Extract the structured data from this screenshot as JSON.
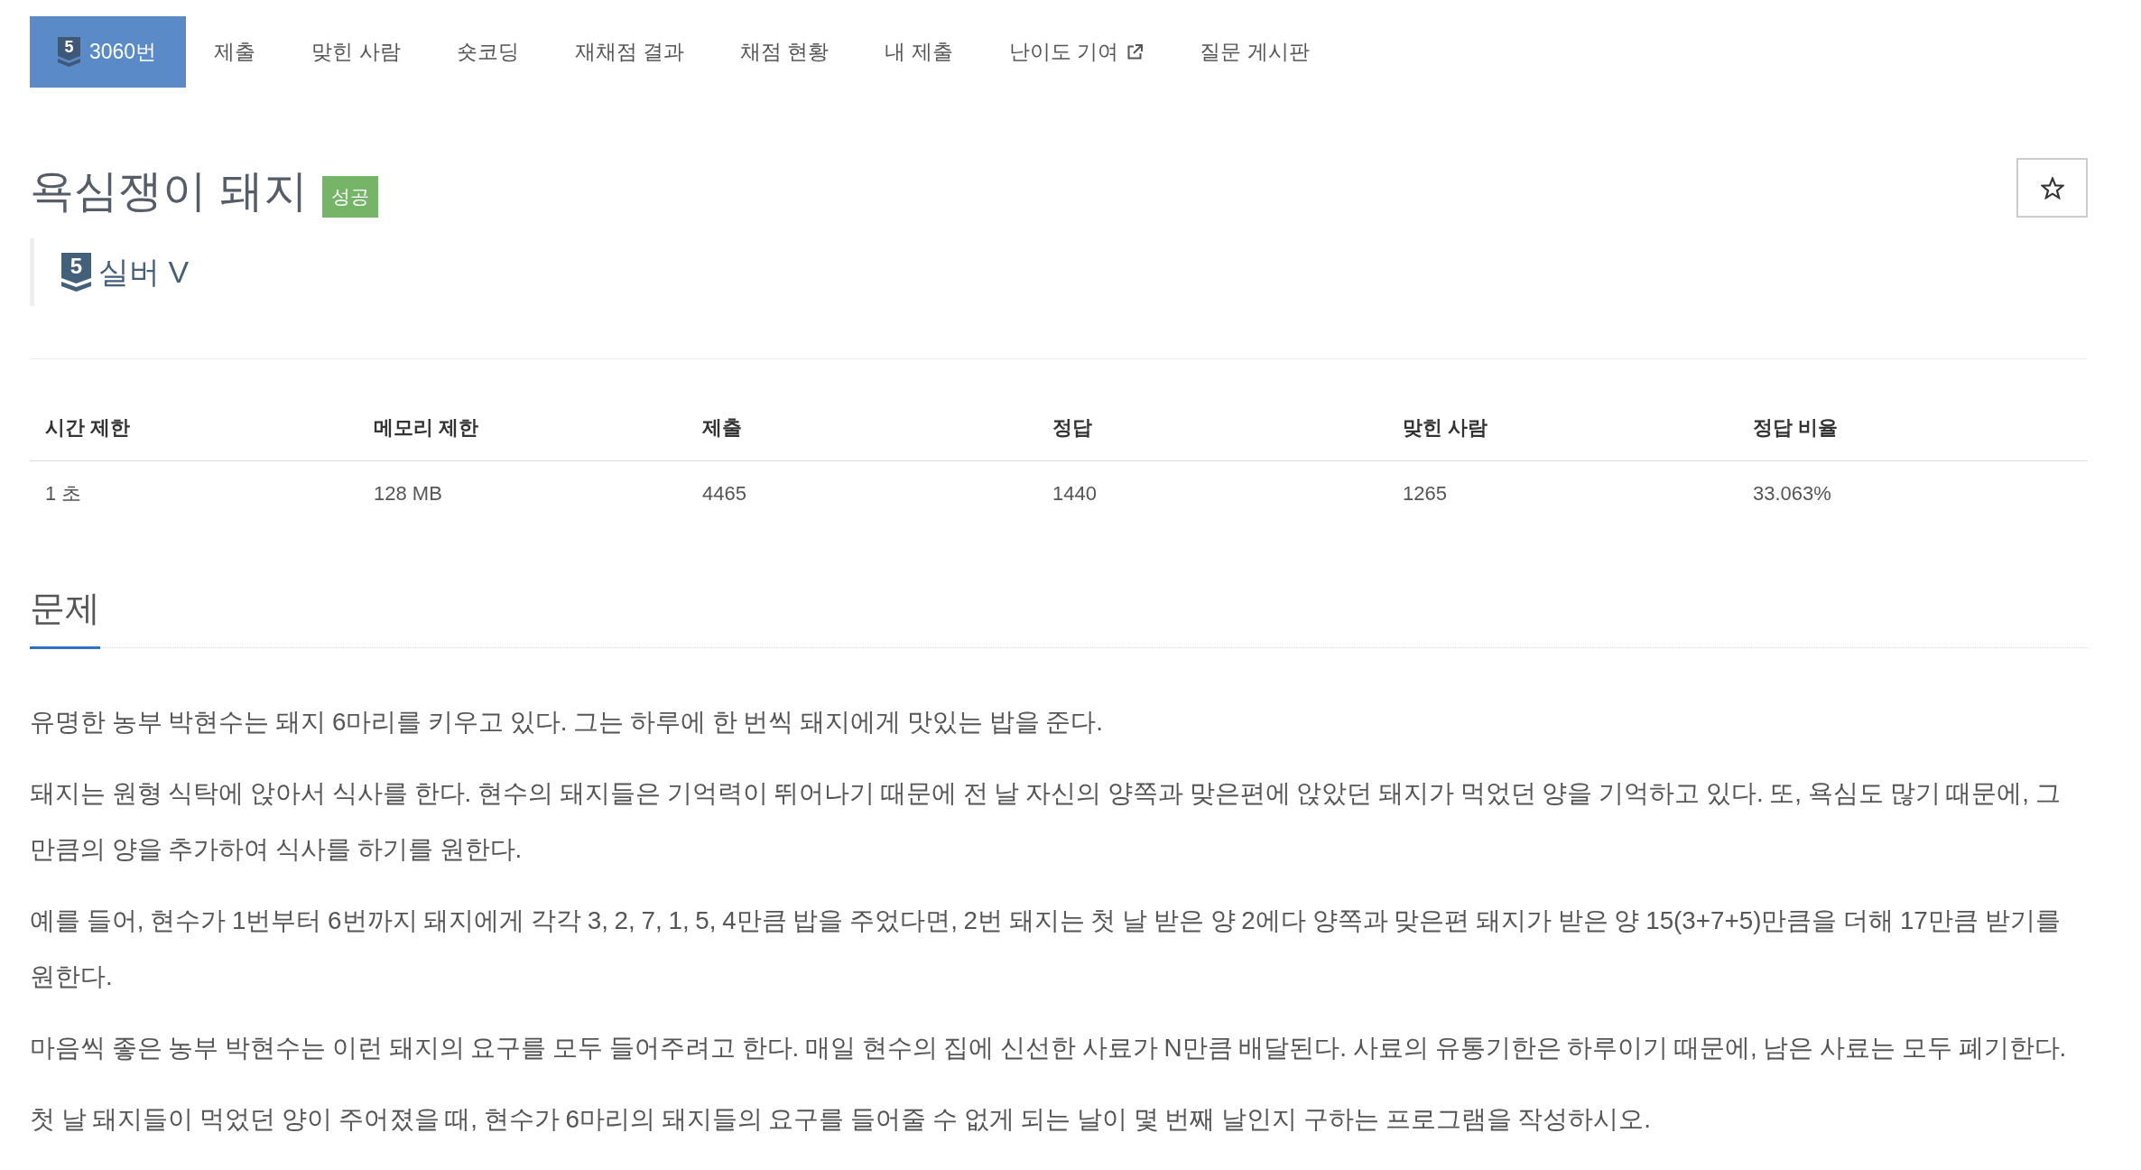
{
  "nav_tabs": [
    {
      "label": "3060번",
      "tier": "5",
      "selected": true,
      "external": false
    },
    {
      "label": "제출",
      "selected": false,
      "external": false
    },
    {
      "label": "맞힌 사람",
      "selected": false,
      "external": false
    },
    {
      "label": "숏코딩",
      "selected": false,
      "external": false
    },
    {
      "label": "재채점 결과",
      "selected": false,
      "external": false
    },
    {
      "label": "채점 현황",
      "selected": false,
      "external": false
    },
    {
      "label": "내 제출",
      "selected": false,
      "external": false
    },
    {
      "label": "난이도 기여",
      "selected": false,
      "external": true
    },
    {
      "label": "질문 게시판",
      "selected": false,
      "external": false
    }
  ],
  "problem": {
    "title": "욕심쟁이 돼지",
    "status_badge": "성공",
    "tier": {
      "level": "5",
      "name": "실버 V"
    }
  },
  "info_table": {
    "columns": [
      "시간 제한",
      "메모리 제한",
      "제출",
      "정답",
      "맞힌 사람",
      "정답 비율"
    ],
    "rows": [
      [
        "1 초",
        "128 MB",
        "4465",
        "1440",
        "1265",
        "33.063%"
      ]
    ]
  },
  "section": {
    "heading": "문제",
    "paragraphs": [
      "유명한 농부 박현수는 돼지 6마리를 키우고 있다. 그는 하루에 한 번씩 돼지에게 맛있는 밥을 준다.",
      "돼지는 원형 식탁에 앉아서 식사를 한다. 현수의 돼지들은 기억력이 뛰어나기 때문에 전 날 자신의 양쪽과 맞은편에 앉았던 돼지가 먹었던 양을 기억하고 있다. 또, 욕심도 많기 때문에, 그 만큼의 양을 추가하여 식사를 하기를 원한다.",
      "예를 들어, 현수가 1번부터 6번까지 돼지에게 각각 3, 2, 7, 1, 5, 4만큼 밥을 주었다면, 2번 돼지는 첫 날 받은 양 2에다 양쪽과 맞은편 돼지가 받은 양 15(3+7+5)만큼을 더해 17만큼 받기를 원한다.",
      "마음씩 좋은 농부 박현수는 이런 돼지의 요구를 모두 들어주려고 한다. 매일 현수의 집에 신선한 사료가 N만큼 배달된다. 사료의 유통기한은 하루이기 때문에, 남은 사료는 모두 폐기한다.",
      "첫 날 돼지들이 먹었던 양이 주어졌을 때, 현수가 6마리의 돼지들의 요구를 들어줄 수 없게 되는 날이 몇 번째 날인지 구하는 프로그램을 작성하시오."
    ]
  }
}
